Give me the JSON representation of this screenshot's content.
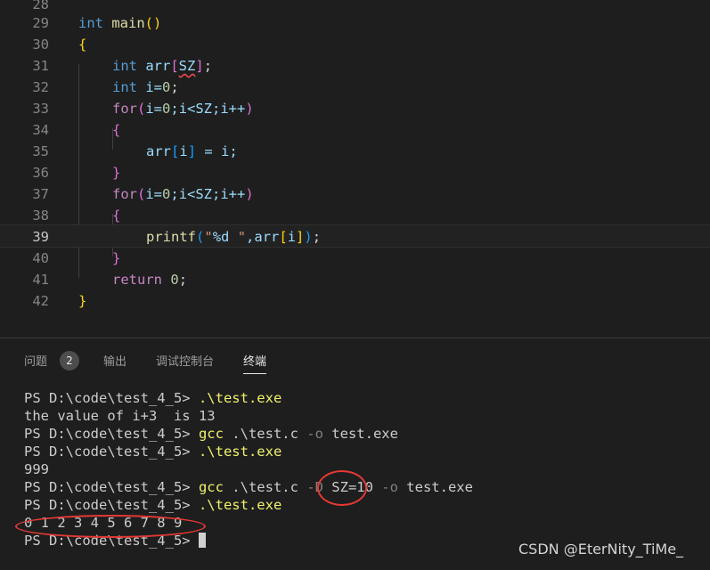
{
  "editor": {
    "lines": [
      {
        "num": "28"
      },
      {
        "num": "29",
        "code": {
          "t1": "int",
          "t2": " main",
          "t3": "(",
          "t4": ")"
        }
      },
      {
        "num": "30",
        "code": {
          "t1": "{"
        }
      },
      {
        "num": "31",
        "code": {
          "t1": "int",
          "t2": " arr",
          "t3": "[",
          "t4": "SZ",
          "t5": "]",
          "t6": ";"
        }
      },
      {
        "num": "32",
        "code": {
          "t1": "int",
          "t2": " i=",
          "t3": "0",
          "t4": ";"
        }
      },
      {
        "num": "33",
        "code": {
          "t1": "for",
          "t2": "(",
          "t3": "i=",
          "t4": "0",
          "t5": ";i<SZ;i++",
          "t6": ")"
        }
      },
      {
        "num": "34",
        "code": {
          "t1": "{"
        }
      },
      {
        "num": "35",
        "code": {
          "t1": "arr",
          "t2": "[",
          "t3": "i",
          "t4": "]",
          "t5": " = i;"
        }
      },
      {
        "num": "36",
        "code": {
          "t1": "}"
        }
      },
      {
        "num": "37",
        "code": {
          "t1": "for",
          "t2": "(",
          "t3": "i=",
          "t4": "0",
          "t5": ";i<SZ;i++",
          "t6": ")"
        }
      },
      {
        "num": "38",
        "code": {
          "t1": "{"
        }
      },
      {
        "num": "39",
        "code": {
          "t1": "printf",
          "t2": "(",
          "t3": "\"",
          "t4": "%d",
          "t5": " \"",
          "t6": ",arr",
          "t7": "[",
          "t8": "i",
          "t9": "]",
          "t10": ")",
          "t11": ";"
        }
      },
      {
        "num": "40",
        "code": {
          "t1": "}"
        }
      },
      {
        "num": "41",
        "code": {
          "t1": "return",
          "t2": " ",
          "t3": "0",
          "t4": ";"
        }
      },
      {
        "num": "42",
        "code": {
          "t1": "}"
        }
      }
    ]
  },
  "panel": {
    "tabs": {
      "problems": "问题",
      "problems_count": "2",
      "output": "输出",
      "debug": "调试控制台",
      "terminal": "终端"
    }
  },
  "terminal": {
    "l1": {
      "prompt": "PS D:\\code\\test_4_5> ",
      "cmd": ".\\test.exe"
    },
    "l2": {
      "text": "the value of i+3  is 13"
    },
    "l3": {
      "prompt": "PS D:\\code\\test_4_5> ",
      "cmd": "gcc",
      "rest1": " .\\test.c ",
      "flag": "-o",
      "rest2": " test.exe"
    },
    "l4": {
      "prompt": "PS D:\\code\\test_4_5> ",
      "cmd": ".\\test.exe"
    },
    "l5": {
      "text": "999"
    },
    "l6": {
      "prompt": "PS D:\\code\\test_4_5> ",
      "cmd": "gcc",
      "rest1": " .\\test.c ",
      "flag": "-D",
      "def": " SZ=10 ",
      "flag2": "-o",
      "rest2": " test.exe"
    },
    "l7": {
      "prompt": "PS D:\\code\\test_4_5> ",
      "cmd": ".\\test.exe"
    },
    "l8": {
      "text": "0 1 2 3 4 5 6 7 8 9"
    },
    "l9": {
      "prompt": "PS D:\\code\\test_4_5> "
    }
  },
  "watermark": "CSDN @EterNity_TiMe_",
  "colors": {
    "keyword": "#569cd6",
    "control": "#c586c0",
    "function": "#dcdcaa",
    "variable": "#9cdcfe",
    "number": "#b5cea8",
    "string": "#ce9178",
    "annotation": "#e53935"
  }
}
